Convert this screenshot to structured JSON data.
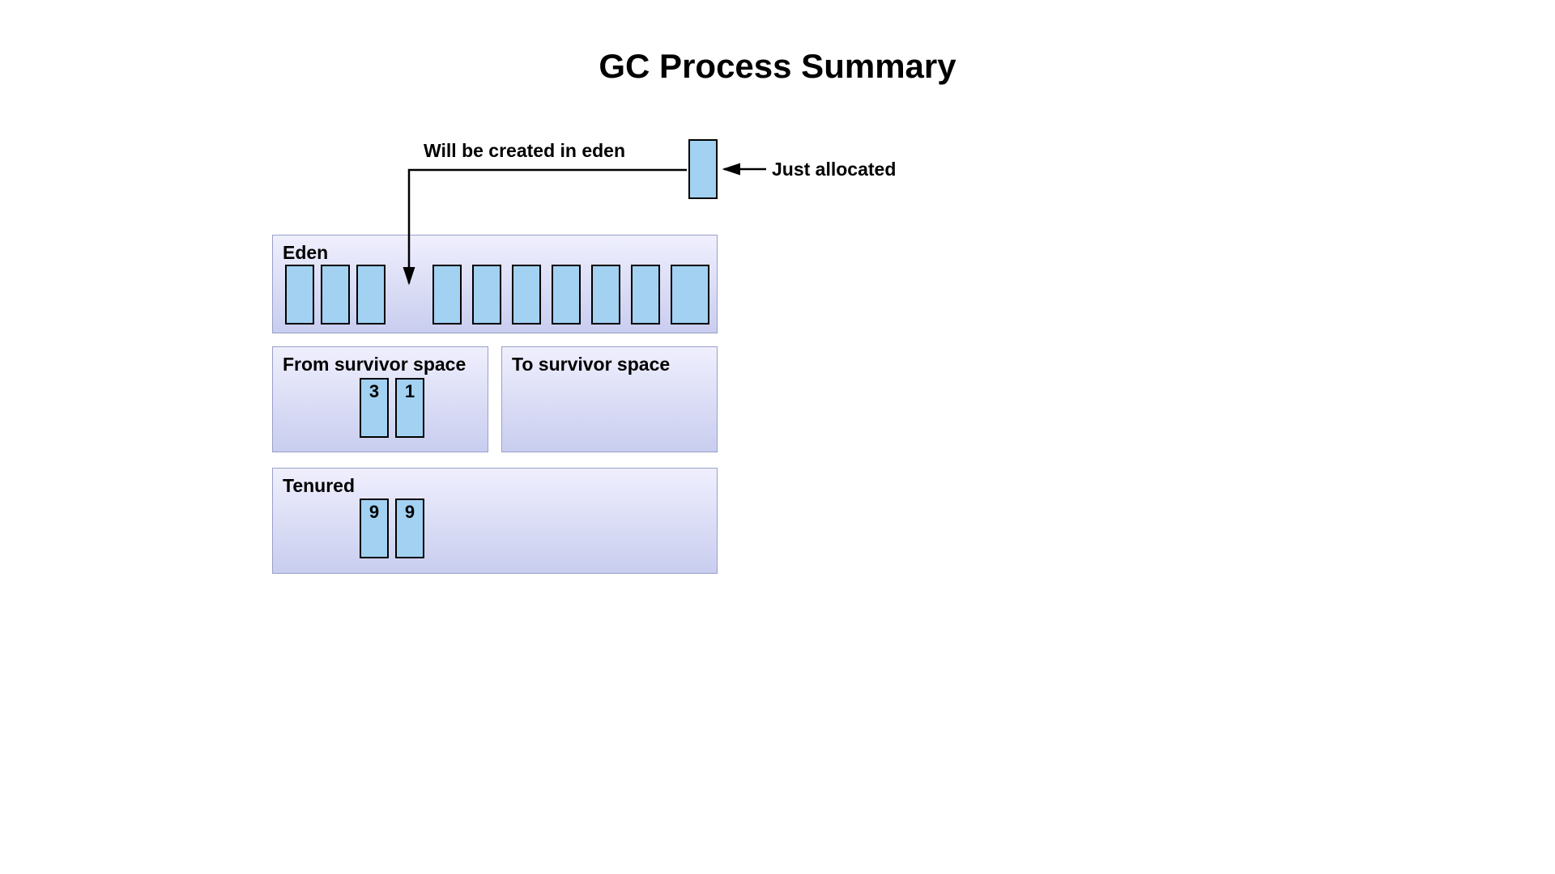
{
  "title": "GC Process Summary",
  "annotations": {
    "will_be_created": "Will be created in eden",
    "just_allocated": "Just allocated"
  },
  "regions": {
    "eden": {
      "label": "Eden"
    },
    "from": {
      "label": "From survivor space"
    },
    "to": {
      "label": "To survivor space"
    },
    "tenured": {
      "label": "Tenured"
    }
  },
  "blocks": {
    "allocated": {
      "value": ""
    },
    "eden": [
      {
        "value": ""
      },
      {
        "value": ""
      },
      {
        "value": ""
      },
      {
        "value": ""
      },
      {
        "value": ""
      },
      {
        "value": ""
      },
      {
        "value": ""
      },
      {
        "value": ""
      },
      {
        "value": ""
      },
      {
        "value": ""
      }
    ],
    "from": [
      {
        "value": "3"
      },
      {
        "value": "1"
      }
    ],
    "tenured": [
      {
        "value": "9"
      },
      {
        "value": "9"
      }
    ]
  }
}
